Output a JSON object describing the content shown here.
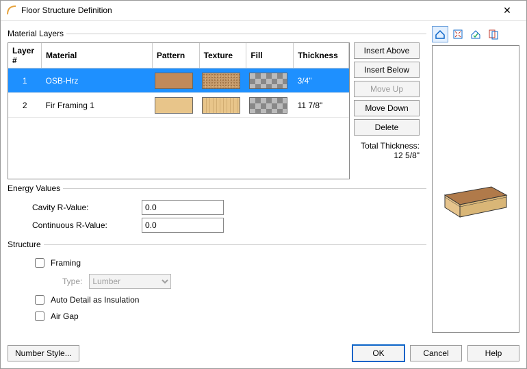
{
  "window": {
    "title": "Floor Structure Definition"
  },
  "material_layers": {
    "legend": "Material Layers",
    "headers": {
      "layer": "Layer #",
      "material": "Material",
      "pattern": "Pattern",
      "texture": "Texture",
      "fill": "Fill",
      "thickness": "Thickness"
    },
    "rows": [
      {
        "num": "1",
        "material": "OSB-Hrz",
        "thickness": "3/4\"",
        "selected": true
      },
      {
        "num": "2",
        "material": "Fir Framing 1",
        "thickness": "11 7/8\"",
        "selected": false
      }
    ],
    "buttons": {
      "insert_above": "Insert Above",
      "insert_below": "Insert Below",
      "move_up": "Move Up",
      "move_down": "Move Down",
      "delete": "Delete"
    },
    "total_label": "Total Thickness:",
    "total_value": "12 5/8\""
  },
  "energy": {
    "legend": "Energy Values",
    "cavity_label": "Cavity R-Value:",
    "cavity_value": "0.0",
    "continuous_label": "Continuous R-Value:",
    "continuous_value": "0.0"
  },
  "structure": {
    "legend": "Structure",
    "framing_label": "Framing",
    "type_label": "Type:",
    "type_value": "Lumber",
    "auto_detail_label": "Auto Detail as Insulation",
    "air_gap_label": "Air Gap"
  },
  "footer": {
    "number_style": "Number Style...",
    "ok": "OK",
    "cancel": "Cancel",
    "help": "Help"
  },
  "preview_tools": {
    "t1": "house-view-icon",
    "t2": "fit-icon",
    "t3": "house-check-icon",
    "t4": "layers-icon"
  }
}
